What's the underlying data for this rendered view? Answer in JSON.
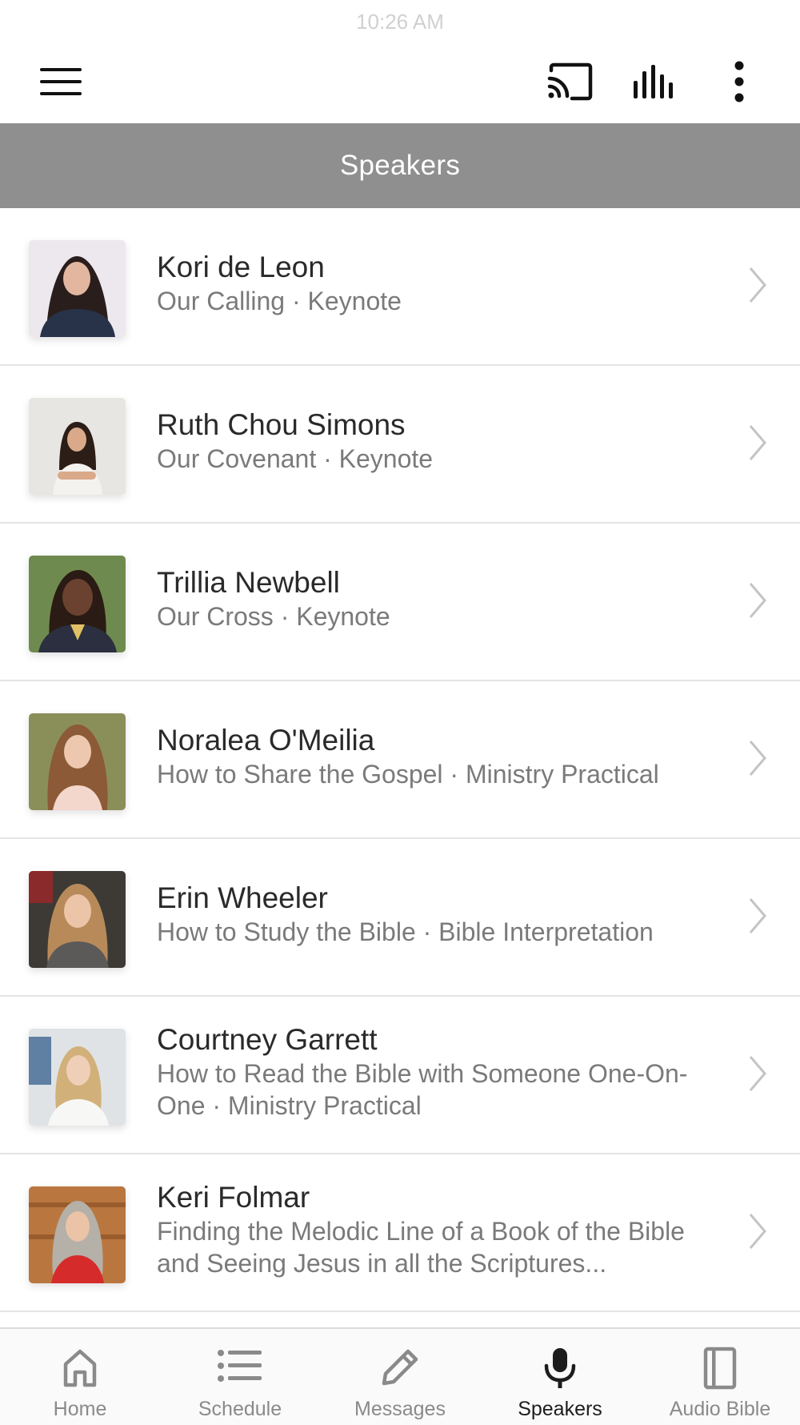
{
  "status_bar": {
    "time": "10:26 AM"
  },
  "header": {
    "title": "Speakers"
  },
  "speakers": [
    {
      "name": "Kori de Leon",
      "subtitle": "Our Calling · Keynote"
    },
    {
      "name": "Ruth Chou Simons",
      "subtitle": "Our Covenant · Keynote"
    },
    {
      "name": "Trillia Newbell",
      "subtitle": "Our Cross · Keynote"
    },
    {
      "name": "Noralea O'Meilia",
      "subtitle": "How to Share the Gospel · Ministry Practical"
    },
    {
      "name": "Erin Wheeler",
      "subtitle": "How to Study the Bible · Bible Interpretation"
    },
    {
      "name": "Courtney Garrett",
      "subtitle": "How to Read the Bible with Someone One-On-One · Ministry Practical"
    },
    {
      "name": "Keri Folmar",
      "subtitle": "Finding the Melodic Line of a Book of the Bible and Seeing Jesus in all the Scriptures..."
    }
  ],
  "tabs": [
    {
      "label": "Home",
      "icon": "home-icon"
    },
    {
      "label": "Schedule",
      "icon": "list-icon"
    },
    {
      "label": "Messages",
      "icon": "pencil-icon"
    },
    {
      "label": "Speakers",
      "icon": "microphone-icon",
      "active": true
    },
    {
      "label": "Audio Bible",
      "icon": "book-icon"
    }
  ],
  "colors": {
    "header_band": "#8f8f8f",
    "active_tab": "#1d1d1d",
    "inactive_tab": "#8a8a8a"
  }
}
